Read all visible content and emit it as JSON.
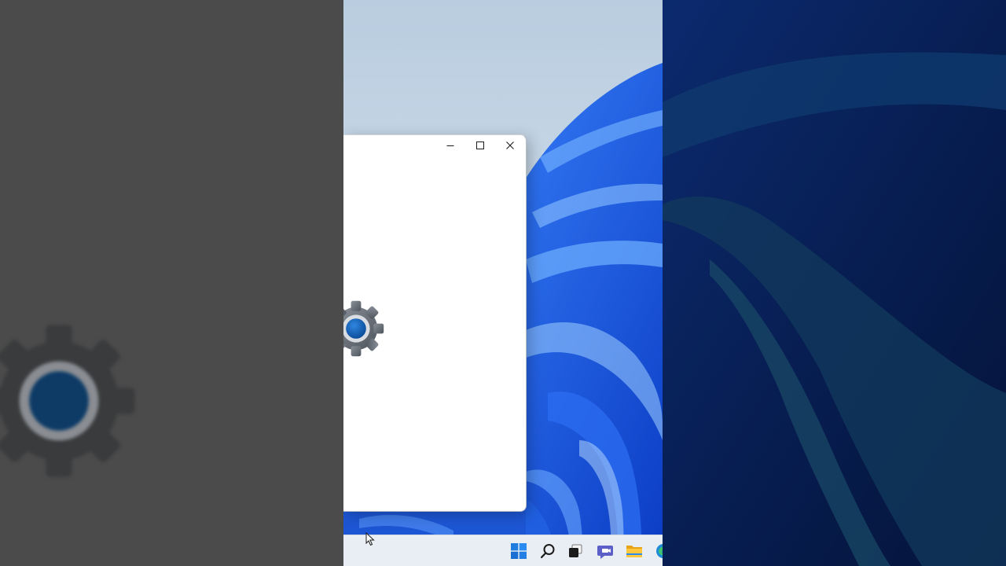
{
  "window": {
    "title": "",
    "controls": {
      "minimize": "minimize",
      "maximize": "maximize",
      "close": "close"
    },
    "splash_icon": "settings-gear-icon"
  },
  "taskbar": {
    "items": [
      {
        "name": "start",
        "icon": "windows-start-icon"
      },
      {
        "name": "search",
        "icon": "search-icon"
      },
      {
        "name": "task-view",
        "icon": "task-view-icon"
      },
      {
        "name": "chat",
        "icon": "teams-chat-icon"
      },
      {
        "name": "file-explorer",
        "icon": "folder-icon"
      },
      {
        "name": "edge",
        "icon": "edge-browser-icon"
      }
    ]
  },
  "colors": {
    "accent": "#0a5fb4",
    "gear": "#5f6670",
    "wallpaper_blue": "#1f5fe0",
    "taskbar": "#e9eef4",
    "left_panel": "#4b4b4b",
    "right_panel": "#071a4e"
  }
}
